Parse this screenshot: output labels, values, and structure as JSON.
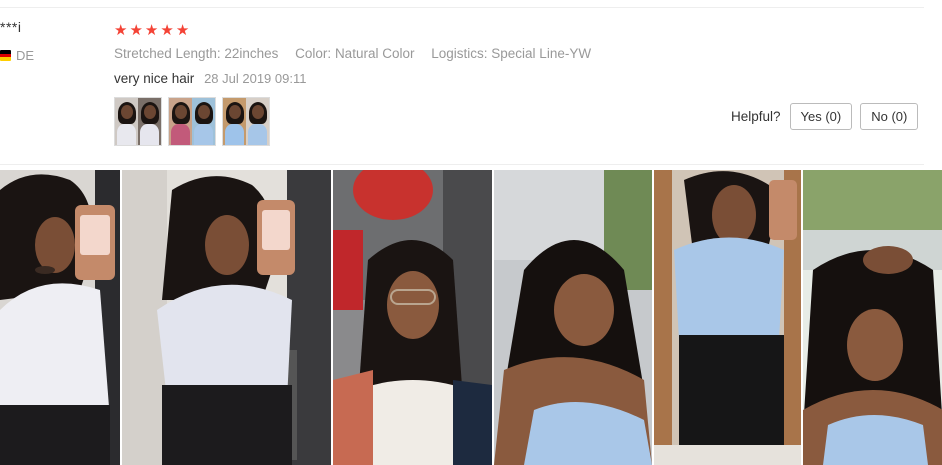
{
  "review": {
    "user_name": "***i",
    "country_code": "DE",
    "flag_colors": [
      "#000000",
      "#dd0000",
      "#ffce00"
    ],
    "rating": 5,
    "star_glyph": "★",
    "star_color": "#f44336",
    "attributes": [
      {
        "label": "Stretched Length:",
        "value": "22inches"
      },
      {
        "label": "Color:",
        "value": "Natural Color"
      },
      {
        "label": "Logistics:",
        "value": "Special Line-YW"
      }
    ],
    "feedback_text": "very nice hair",
    "date": "28 Jul 2019 09:11",
    "thumbnails": [
      {
        "name": "thumb-1",
        "tones": [
          "#cfc9c4",
          "#7a6f68"
        ],
        "tops": [
          "#e8e8ee",
          "#e6e6ee"
        ]
      },
      {
        "name": "thumb-2",
        "tones": [
          "#c9a38a",
          "#9ec1d9"
        ],
        "tops": [
          "#c25a7a",
          "#a6c6e8"
        ]
      },
      {
        "name": "thumb-3",
        "tones": [
          "#c49a6c",
          "#d7cfc7"
        ],
        "tops": [
          "#9ec3ea",
          "#a6c6e8"
        ]
      }
    ],
    "helpful": {
      "label": "Helpful?",
      "yes_label": "Yes (0)",
      "no_label": "No (0)"
    }
  },
  "gallery": {
    "photos": [
      {
        "name": "review-photo-1",
        "description_icon": "photo-icon"
      },
      {
        "name": "review-photo-2",
        "description_icon": "photo-icon"
      },
      {
        "name": "review-photo-3",
        "description_icon": "photo-icon"
      },
      {
        "name": "review-photo-4",
        "description_icon": "photo-icon"
      },
      {
        "name": "review-photo-5",
        "description_icon": "photo-icon"
      },
      {
        "name": "review-photo-6",
        "description_icon": "photo-icon"
      }
    ]
  }
}
